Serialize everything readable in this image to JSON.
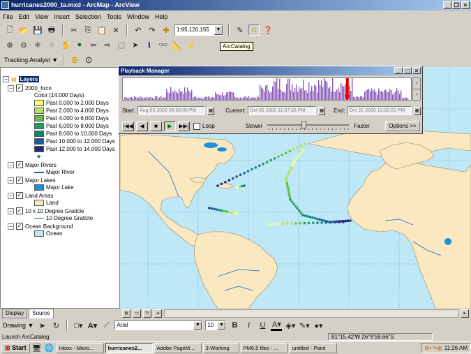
{
  "window": {
    "title": "hurricanes2000_ta.mxd - ArcMap - ArcView"
  },
  "menu": [
    "File",
    "Edit",
    "View",
    "Insert",
    "Selection",
    "Tools",
    "Window",
    "Help"
  ],
  "standard_toolbar": {
    "scale": "1:95,120,155"
  },
  "tooltip": "ArcCatalog",
  "tracking_toolbar": {
    "label": "Tracking Analyst ▼"
  },
  "toc": {
    "layers_title": "Layers",
    "items": [
      {
        "label": "2000_hrcn"
      },
      {
        "label": "Color (14.000 Days)"
      },
      {
        "label": "Past 0.000 to 2.000 Days",
        "color": "#ffff80"
      },
      {
        "label": "Past 2.000 to 4.000 Days",
        "color": "#b8e060"
      },
      {
        "label": "Past 4.000 to 6.000 Days",
        "color": "#60c040"
      },
      {
        "label": "Past 6.000 to 8.000 Days",
        "color": "#20a060"
      },
      {
        "label": "Past 8.000 to 10.000 Days",
        "color": "#108878"
      },
      {
        "label": "Past 10.000 to 12.000 Days",
        "color": "#1a5aa0"
      },
      {
        "label": "Past 12.000 to 14.000 Days",
        "color": "#28287a"
      },
      {
        "label": "Major Rivers"
      },
      {
        "label": "Major River"
      },
      {
        "label": "Major Lakes"
      },
      {
        "label": "Major Lake",
        "color": "#1e90d8"
      },
      {
        "label": "Land Areas"
      },
      {
        "label": "Land",
        "color": "#fae8c0"
      },
      {
        "label": "10 x 10 Degree Graticle"
      },
      {
        "label": "10 Degree Graticle"
      },
      {
        "label": "Ocean Background"
      },
      {
        "label": "Ocean",
        "color": "#bee8f5"
      }
    ],
    "tabs": [
      "Display",
      "Source"
    ]
  },
  "playback": {
    "title": "Playback Manager",
    "start_label": "Start:",
    "start_value": "Aug 03 2000 06:00:00 PM",
    "current_label": "Current:",
    "current_value": "Oct 05 2000 11:07:33 PM",
    "end_label": "End:",
    "end_value": "Oct 22 2000 12:00:00 PM",
    "loop_label": "Loop",
    "slower_label": "Slower",
    "faster_label": "Faster",
    "options_label": "Options >>",
    "current_position": 0.78,
    "speed_position": 0.45
  },
  "drawing_toolbar": {
    "drawing_label": "Drawing ▼",
    "font": "Arial",
    "size": "10"
  },
  "status": {
    "message": "Launch ArcCatalog",
    "coordinates": "81°15.42'W  26°9'58.66\"S"
  },
  "taskbar": {
    "start": "Start",
    "tasks": [
      "Inbox - Micro...",
      "hurricanes2...",
      "Adobe PageM...",
      "3-Working",
      "PM6.5 files - ...",
      "untitled - Paint"
    ],
    "clock": "11:26 AM"
  },
  "colors": {
    "title_bar": "#0a246a",
    "ocean": "#bee8f5",
    "land": "#fae8c0"
  }
}
